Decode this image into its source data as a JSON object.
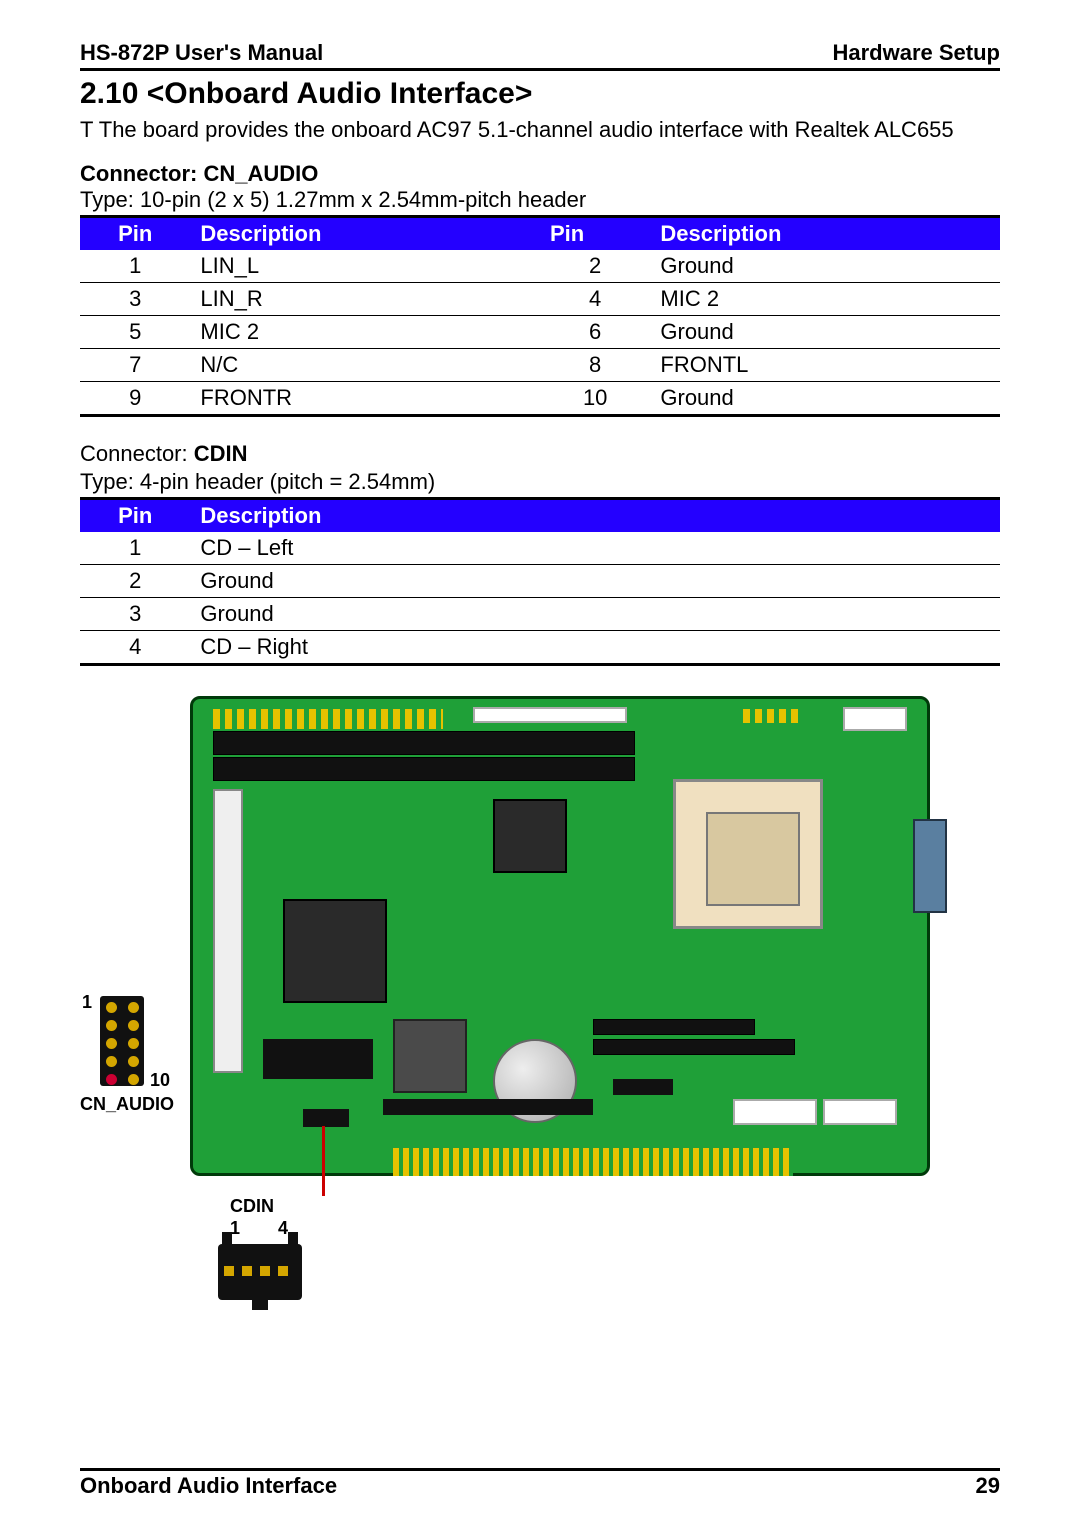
{
  "header": {
    "left": "HS-872P User's Manual",
    "right": "Hardware Setup"
  },
  "section": {
    "number": "2.10",
    "title": "<Onboard Audio Interface>",
    "intro": "T The board provides the onboard AC97 5.1-channel audio interface with Realtek ALC655"
  },
  "connector1": {
    "label": "Connector: CN_AUDIO",
    "type": "Type: 10-pin (2 x 5) 1.27mm x 2.54mm-pitch header",
    "headers": {
      "pin": "Pin",
      "desc": "Description"
    },
    "rows": [
      {
        "p1": "1",
        "d1": "LIN_L",
        "p2": "2",
        "d2": "Ground"
      },
      {
        "p1": "3",
        "d1": "LIN_R",
        "p2": "4",
        "d2": "MIC 2"
      },
      {
        "p1": "5",
        "d1": "MIC 2",
        "p2": "6",
        "d2": "Ground"
      },
      {
        "p1": "7",
        "d1": "N/C",
        "p2": "8",
        "d2": "FRONTL"
      },
      {
        "p1": "9",
        "d1": "FRONTR",
        "p2": "10",
        "d2": "Ground"
      }
    ]
  },
  "connector2": {
    "label_prefix": "Connector: ",
    "label_bold": "CDIN",
    "type": "Type: 4-pin header (pitch = 2.54mm)",
    "headers": {
      "pin": "Pin",
      "desc": "Description"
    },
    "rows": [
      {
        "p": "1",
        "d": "CD – Left"
      },
      {
        "p": "2",
        "d": "Ground"
      },
      {
        "p": "3",
        "d": "Ground"
      },
      {
        "p": "4",
        "d": "CD – Right"
      }
    ]
  },
  "diagram": {
    "cn_audio_pin1": "1",
    "cn_audio_pin10": "10",
    "cn_audio_label": "CN_AUDIO",
    "cdin_label": "CDIN",
    "cdin_pin1": "1",
    "cdin_pin4": "4"
  },
  "footer": {
    "left": "Onboard Audio Interface",
    "right": "29"
  }
}
